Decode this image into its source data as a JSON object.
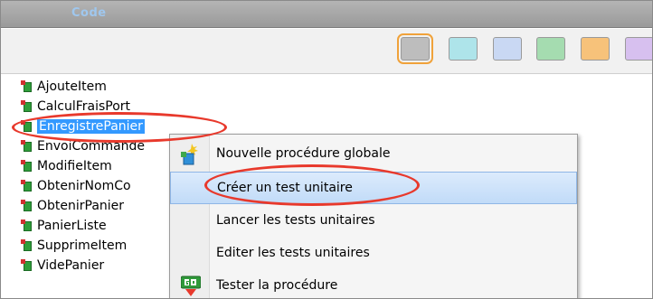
{
  "window": {
    "title": "Code"
  },
  "toolbar": {
    "swatches": [
      {
        "icon": "gray-swatch-icon",
        "color": "#bdbdbd",
        "selected": true
      },
      {
        "icon": "cyan-swatch-icon",
        "color": "#aee4ea",
        "selected": false
      },
      {
        "icon": "blue-swatch-icon",
        "color": "#c9d8f3",
        "selected": false
      },
      {
        "icon": "green-swatch-icon",
        "color": "#a5dcb0",
        "selected": false
      },
      {
        "icon": "orange-swatch-icon",
        "color": "#f7c27a",
        "selected": false
      },
      {
        "icon": "purple-swatch-icon",
        "color": "#d7c0ef",
        "selected": false
      }
    ]
  },
  "tree": {
    "items": [
      {
        "label": "AjouteItem"
      },
      {
        "label": "CalculFraisPort"
      },
      {
        "label": "EnregistrePanier",
        "selected": true
      },
      {
        "label": "EnvoiCommande"
      },
      {
        "label": "ModifieItem"
      },
      {
        "label": "ObtenirNomCo"
      },
      {
        "label": "ObtenirPanier"
      },
      {
        "label": "PanierListe"
      },
      {
        "label": "SupprimeItem"
      },
      {
        "label": "VidePanier"
      }
    ]
  },
  "context_menu": {
    "items": [
      {
        "label": "Nouvelle procédure globale",
        "icon": "new-procedure-icon"
      },
      {
        "label": "Créer un test unitaire",
        "hover": true
      },
      {
        "label": "Lancer les tests unitaires"
      },
      {
        "label": "Editer les tests unitaires"
      },
      {
        "label": "Tester la procédure",
        "icon": "go-icon"
      }
    ]
  },
  "colors": {
    "highlight_ring": "#e8392c",
    "selection": "#3399ff"
  }
}
